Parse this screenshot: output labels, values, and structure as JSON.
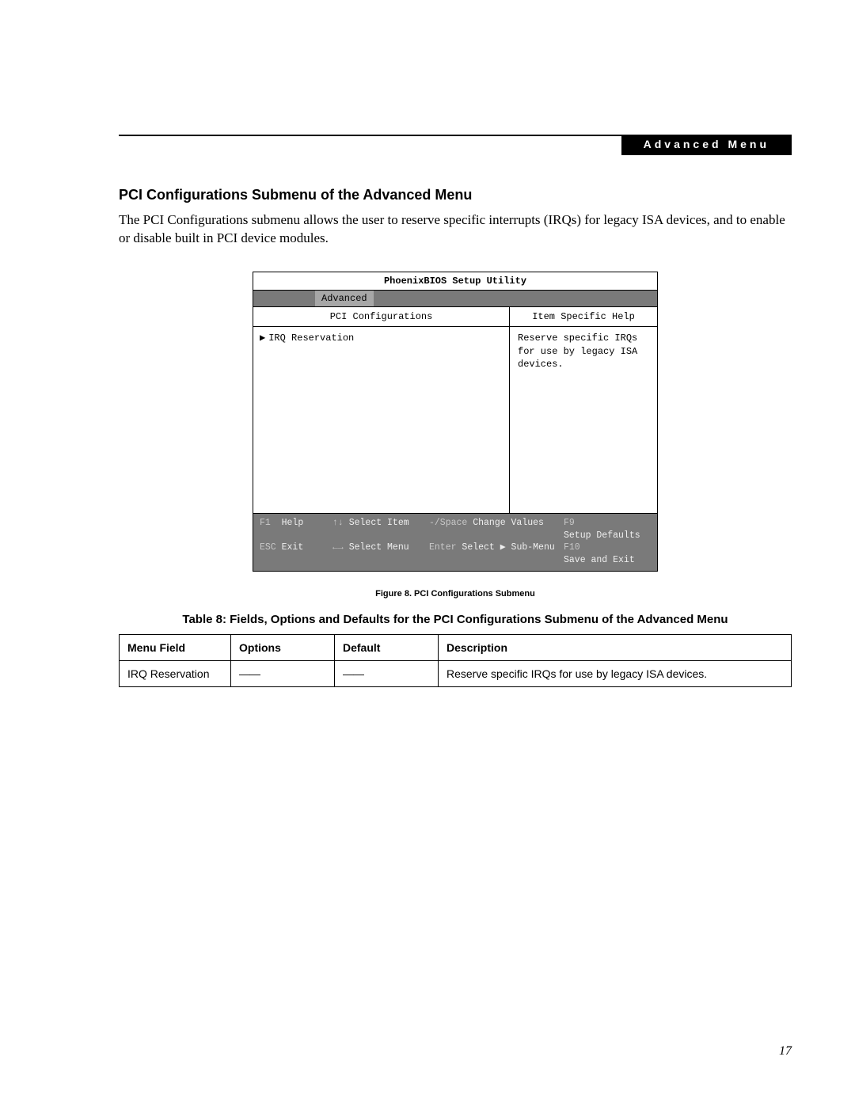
{
  "header": {
    "chip": "Advanced Menu"
  },
  "section": {
    "title": "PCI Configurations Submenu of the Advanced Menu",
    "paragraph": "The PCI Configurations submenu allows the user to reserve specific interrupts (IRQs) for legacy ISA devices, and to enable or disable built in PCI device modules."
  },
  "bios": {
    "title": "PhoenixBIOS Setup Utility",
    "active_tab": "Advanced",
    "left_header": "PCI Configurations",
    "right_header": "Item Specific Help",
    "menu_item": "IRQ Reservation",
    "help_text": "Reserve specific IRQs for use by legacy ISA devices.",
    "footer": {
      "r1": {
        "k1": "F1",
        "v1": "Help",
        "k2": "↑↓",
        "v2": "Select Item",
        "k3": "-/Space",
        "v3": "Change Values",
        "k4": "F9",
        "v4": "Setup Defaults"
      },
      "r2": {
        "k1": "ESC",
        "v1": "Exit",
        "k2": "←→",
        "v2": "Select Menu",
        "k3": "Enter",
        "v3": "Select ▶ Sub-Menu",
        "k4": "F10",
        "v4": "Save and Exit"
      }
    }
  },
  "figure_caption": "Figure 8.  PCI Configurations Submenu",
  "table": {
    "title": "Table 8: Fields, Options and Defaults for the PCI Configurations Submenu of the Advanced Menu",
    "headers": {
      "menu_field": "Menu Field",
      "options": "Options",
      "default": "Default",
      "description": "Description"
    },
    "rows": [
      {
        "menu_field": "IRQ Reservation",
        "options": "——",
        "default": "——",
        "description": "Reserve specific IRQs for use by legacy ISA devices."
      }
    ]
  },
  "page_number": "17"
}
